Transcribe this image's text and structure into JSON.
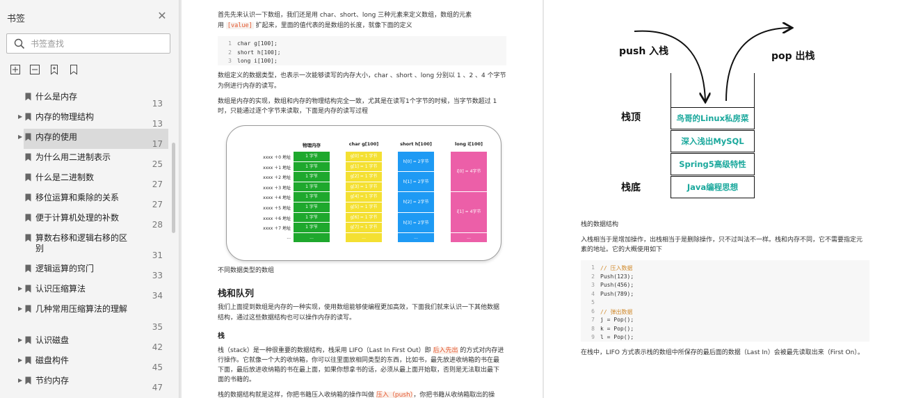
{
  "sidebar": {
    "title": "书签",
    "search_placeholder": "书签查找",
    "items": [
      {
        "label": "什么是内存",
        "page": "13",
        "has_arrow": false
      },
      {
        "label": "内存的物理结构",
        "page": "13",
        "has_arrow": true
      },
      {
        "label": "内存的使用",
        "page": "17",
        "has_arrow": true,
        "active": true
      },
      {
        "label": "为什么用二进制表示",
        "page": "25",
        "has_arrow": false
      },
      {
        "label": "什么是二进制数",
        "page": "27",
        "has_arrow": false
      },
      {
        "label": "移位运算和乘除的关系",
        "page": "27",
        "has_arrow": false
      },
      {
        "label": "便于计算机处理的补数",
        "page": "28",
        "has_arrow": false
      },
      {
        "label": "算数右移和逻辑右移的区别",
        "page": "31",
        "has_arrow": false
      },
      {
        "label": "逻辑运算的窍门",
        "page": "33",
        "has_arrow": false
      },
      {
        "label": "认识压缩算法",
        "page": "34",
        "has_arrow": true
      },
      {
        "label": "几种常用压缩算法的理解",
        "page": "35",
        "has_arrow": true
      },
      {
        "label": "认识磁盘",
        "page": "42",
        "has_arrow": true
      },
      {
        "label": "磁盘构件",
        "page": "45",
        "has_arrow": true
      },
      {
        "label": "节约内存",
        "page": "47",
        "has_arrow": true
      }
    ]
  },
  "left_page": {
    "intro_1": "首先先来认识一下数组，我们还是用 char、short、long 三种元素来定义数组，数组的元素",
    "intro_2a": "用 ",
    "intro_code": "[value]",
    "intro_2b": " 扩起来，里面的值代表的是数组的长度，就像下面的定义",
    "code1": [
      {
        "n": "1",
        "c": "char g[100];"
      },
      {
        "n": "2",
        "c": "short h[100];"
      },
      {
        "n": "3",
        "c": "long i[100];"
      }
    ],
    "para2_1": "数组定义的数据类型，也表示一次能够读写的内存大小，char 、short 、long 分别以 1 、2 、4 个字节",
    "para2_2": "为例进行内存的读写。",
    "para3_1": "数组是内存的实现，数组和内存的物理结构完全一致，尤其是在读写1个字节的时候，当字节数超过 1",
    "para3_2": "时，只能通过逐个字节来读取，下面是内存的读写过程",
    "diagram": {
      "headers": [
        "物理内存",
        "char g[100]",
        "short h[100]",
        "long i[100]"
      ],
      "addresses": [
        "xxxx ＋0 地址",
        "xxxx ＋1 地址",
        "xxxx ＋2 地址",
        "xxxx ＋3 地址",
        "xxxx ＋4 地址",
        "xxxx ＋5 地址",
        "xxxx ＋6 地址",
        "xxxx ＋7 地址",
        "..."
      ],
      "phys": [
        "1 字节",
        "1 字节",
        "1 字节",
        "1 字节",
        "1 字节",
        "1 字节",
        "1 字节",
        "1 字节",
        "..."
      ],
      "char": [
        "g[0] = 1 字节",
        "g[1] = 1 字节",
        "g[2] = 1 字节",
        "g[3] = 1 字节",
        "g[4] = 1 字节",
        "g[5] = 1 字节",
        "g[6] = 1 字节",
        "g[7] = 1 字节",
        "..."
      ],
      "short": [
        "h[0] = 2字节",
        "h[1] = 2字节",
        "h[2] = 2字节",
        "h[3] = 2字节",
        "..."
      ],
      "long": [
        "i[0] = 4字节",
        "i[1] = 4字节",
        "..."
      ],
      "colors": {
        "phys": "#1ea82d",
        "char": "#f4e032",
        "short": "#1e9af4",
        "long": "#ec5fa8"
      }
    },
    "caption": "不同数据类型的数组",
    "h_stack_queue": "栈和队列",
    "para4_1": "我们上面提到数组是内存的一种实现，使用数组能够使编程更加高效，下面我们就来认识一下其他数据",
    "para4_2": "结构，通过这些数据结构也可以操作内存的读写。",
    "h_stack": "栈",
    "para5_1a": "栈（stack）是一种很重要的数据结构，栈采用 LIFO（Last In First Out）即 ",
    "para5_1hl": "后入先出",
    "para5_1b": " 的方式对内存进",
    "para5_2": "行操作。它就像一个大的收纳箱，你可以往里面放相同类型的东西，比如书，最先放进收纳箱的书在最",
    "para5_3": "下面，最后放进收纳箱的书在最上面，如果你想拿书的话，必须从最上面开始取，否则是无法取出最下",
    "para5_4": "面的书籍的。",
    "para6_1a": "栈的数据结构就是这样，你把书籍压入收纳箱的操作叫做 ",
    "para6_1hl": "压入（push）",
    "para6_1b": "，你把书籍从收纳箱取出的操"
  },
  "right_page": {
    "push_label": "push 入栈",
    "pop_label": "pop 出栈",
    "top_label": "栈顶",
    "bottom_label": "栈底",
    "stack_items": [
      "鸟哥的Linux私房菜",
      "深入浅出MySQL",
      "Spring5高级特性",
      "Java编程思想"
    ],
    "caption": "栈的数据结构",
    "para1_1": "入栈相当于是增加操作，出栈相当于是删除操作，只不过叫法不一样。栈和内存不同，它不需要指定元",
    "para1_2": "素的地址。它的大概使用如下",
    "code2": [
      {
        "n": "1",
        "c": "// 压入数据",
        "cmt": true
      },
      {
        "n": "2",
        "c": "Push(123);"
      },
      {
        "n": "3",
        "c": "Push(456);"
      },
      {
        "n": "4",
        "c": "Push(789);"
      },
      {
        "n": "5",
        "c": ""
      },
      {
        "n": "6",
        "c": "// 弹出数据",
        "cmt": true
      },
      {
        "n": "7",
        "c": "j = Pop();"
      },
      {
        "n": "8",
        "c": "k = Pop();"
      },
      {
        "n": "9",
        "c": "l = Pop();"
      }
    ],
    "para2": "在栈中，LIFO 方式表示栈的数组中所保存的最后面的数据（Last In）会被最先读取出来（First On）。"
  }
}
